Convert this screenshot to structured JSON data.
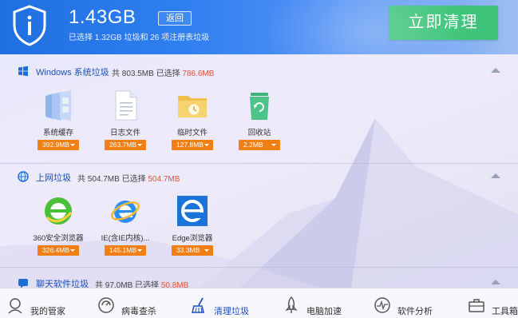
{
  "header": {
    "size_value": "1.43GB",
    "back_label": "返回",
    "sub_info": "已选择 1.32GB 垃圾和 26 项注册表垃圾",
    "clean_label": "立即清理"
  },
  "sections": [
    {
      "title": "Windows 系统垃圾",
      "total_prefix": "共 803.5MB 已选择",
      "selected": "786.6MB",
      "icon": "windows-icon",
      "items": [
        {
          "label": "系统缓存",
          "size": "392.9MB",
          "icon": "system-cache-icon"
        },
        {
          "label": "日志文件",
          "size": "263.7MB",
          "icon": "log-file-icon"
        },
        {
          "label": "临时文件",
          "size": "127.8MB",
          "icon": "temp-folder-icon"
        },
        {
          "label": "回收站",
          "size": "2.2MB",
          "icon": "recycle-bin-icon"
        }
      ]
    },
    {
      "title": "上网垃圾",
      "total_prefix": "共 504.7MB 已选择",
      "selected": "504.7MB",
      "icon": "globe-icon",
      "items": [
        {
          "label": "360安全浏览器",
          "size": "326.4MB",
          "icon": "360-browser-icon"
        },
        {
          "label": "IE(含IE内核)...",
          "size": "145.1MB",
          "icon": "ie-browser-icon"
        },
        {
          "label": "Edge浏览器",
          "size": "33.3MB",
          "icon": "edge-browser-icon"
        }
      ]
    },
    {
      "title": "聊天软件垃圾",
      "total_prefix": "共 97.0MB 已选择",
      "selected": "50.8MB",
      "icon": "chat-icon",
      "items": []
    }
  ],
  "nav": [
    {
      "label": "我的管家",
      "icon": "butler-icon"
    },
    {
      "label": "病毒查杀",
      "icon": "virus-scan-icon"
    },
    {
      "label": "清理垃圾",
      "icon": "broom-icon",
      "active": true
    },
    {
      "label": "电脑加速",
      "icon": "rocket-icon"
    },
    {
      "label": "软件分析",
      "icon": "pulse-icon"
    },
    {
      "label": "工具箱",
      "icon": "toolbox-icon"
    }
  ],
  "colors": {
    "accent_blue": "#1d4fb8",
    "clean_green": "#3ec47a",
    "badge_orange": "#f27f15",
    "selected_red": "#e0533b"
  }
}
